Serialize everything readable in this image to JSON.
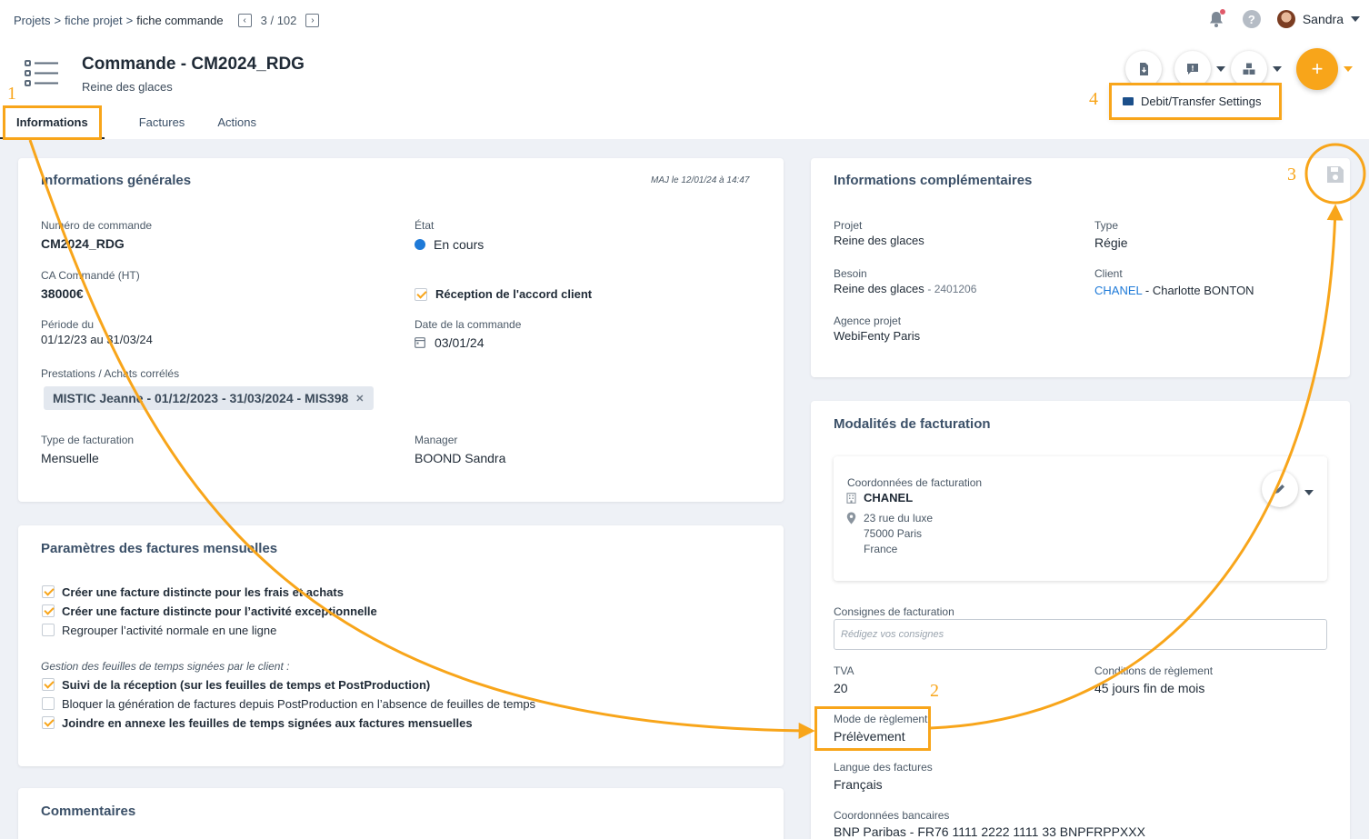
{
  "breadcrumb": [
    "Projets",
    "fiche projet",
    "fiche commande"
  ],
  "pager": {
    "text": "3 / 102"
  },
  "user": {
    "name": "Sandra"
  },
  "header": {
    "title": "Commande - CM2024_RDG",
    "subtitle": "Reine des glaces"
  },
  "tabs": [
    {
      "label": "Informations"
    },
    {
      "label": "Factures"
    },
    {
      "label": "Actions"
    }
  ],
  "dropdown": {
    "debit_transfer": "Debit/Transfer Settings"
  },
  "annotations": [
    "1",
    "2",
    "3",
    "4"
  ],
  "general": {
    "title": "Informations générales",
    "maj": "MAJ le 12/01/24 à 14:47",
    "numero_label": "Numéro de commande",
    "numero": "CM2024_RDG",
    "etat_label": "État",
    "etat": "En cours",
    "ca_label": "CA Commandé (HT)",
    "ca": "38000€",
    "accord": "Réception de l'accord client",
    "periode_label": "Période du",
    "periode": "01/12/23 au 31/03/24",
    "date_label": "Date de la commande",
    "date": "03/01/24",
    "prestations_label": "Prestations / Achats corrélés",
    "prestation_chip": "MISTIC Jeanne - 01/12/2023 - 31/03/2024 - MIS398",
    "type_fact_label": "Type de facturation",
    "type_fact": "Mensuelle",
    "manager_label": "Manager",
    "manager": "BOOND Sandra"
  },
  "params": {
    "title": "Paramètres des factures mensuelles",
    "options": [
      {
        "label": "Créer une facture distincte pour les frais et achats",
        "checked": true
      },
      {
        "label": "Créer une facture distincte pour l’activité exceptionnelle",
        "checked": true
      },
      {
        "label": "Regrouper l’activité normale en une ligne",
        "checked": false
      }
    ],
    "timesheet_title": "Gestion des feuilles de temps signées par le client :",
    "timesheet_options": [
      {
        "label": "Suivi de la réception (sur les feuilles de temps et PostProduction)",
        "checked": true
      },
      {
        "label": "Bloquer la génération de factures depuis PostProduction en l’absence de feuilles de temps",
        "checked": false
      },
      {
        "label": "Joindre en annexe les feuilles de temps signées aux factures mensuelles",
        "checked": true
      }
    ]
  },
  "comments": {
    "title": "Commentaires"
  },
  "complementary": {
    "title": "Informations complémentaires",
    "projet_label": "Projet",
    "projet": "Reine des glaces",
    "type_label": "Type",
    "type": "Régie",
    "besoin_label": "Besoin",
    "besoin": "Reine des glaces",
    "besoin_ref": "- 2401206",
    "client_label": "Client",
    "client": "CHANEL",
    "client_contact": "- Charlotte BONTON",
    "agence_label": "Agence projet",
    "agence": "WebiFenty Paris"
  },
  "billing": {
    "title": "Modalités de facturation",
    "coord_label": "Coordonnées de facturation",
    "company": "CHANEL",
    "address": [
      "23 rue du luxe",
      "75000 Paris",
      "France"
    ],
    "consignes_label": "Consignes de facturation",
    "consignes_placeholder": "Rédigez vos consignes",
    "tva_label": "TVA",
    "tva": "20",
    "conditions_label": "Conditions de règlement",
    "conditions": "45 jours fin de mois",
    "mode_label": "Mode de règlement",
    "mode": "Prélèvement",
    "langue_label": "Langue des factures",
    "langue": "Français",
    "bank_label": "Coordonnées bancaires",
    "bank": "BNP Paribas - FR76 1111 2222 1111 33 BNPFRPPXXX"
  },
  "colors": {
    "accent": "#f8a51a",
    "link": "#1e7ad8",
    "title": "#3b5068"
  }
}
